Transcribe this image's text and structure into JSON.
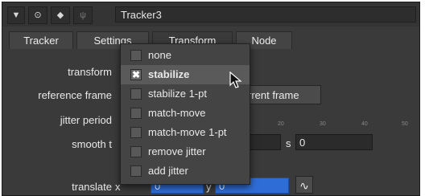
{
  "node_name": "Tracker3",
  "tabs": [
    {
      "label": "Tracker"
    },
    {
      "label": "Settings"
    },
    {
      "label": "Transform"
    },
    {
      "label": "Node"
    }
  ],
  "labels": {
    "transform": "transform",
    "reference_frame": "reference frame",
    "jitter_period": "jitter period",
    "smooth_t": "smooth t",
    "translate": "translate",
    "x": "x",
    "y": "y",
    "s": "s"
  },
  "buttons": {
    "set_current_frame": "rrent frame"
  },
  "fields": {
    "smooth_s": "0",
    "translate_x": "0",
    "translate_y": "0"
  },
  "ruler_ticks": [
    "20",
    "30",
    "40",
    "50"
  ],
  "dropdown": {
    "options": [
      {
        "label": "none",
        "checked": false
      },
      {
        "label": "stabilize",
        "checked": true
      },
      {
        "label": "stabilize 1-pt",
        "checked": false
      },
      {
        "label": "match-move",
        "checked": false
      },
      {
        "label": "match-move 1-pt",
        "checked": false
      },
      {
        "label": "remove jitter",
        "checked": false
      },
      {
        "label": "add jitter",
        "checked": false
      }
    ],
    "check_glyph": "✖"
  }
}
